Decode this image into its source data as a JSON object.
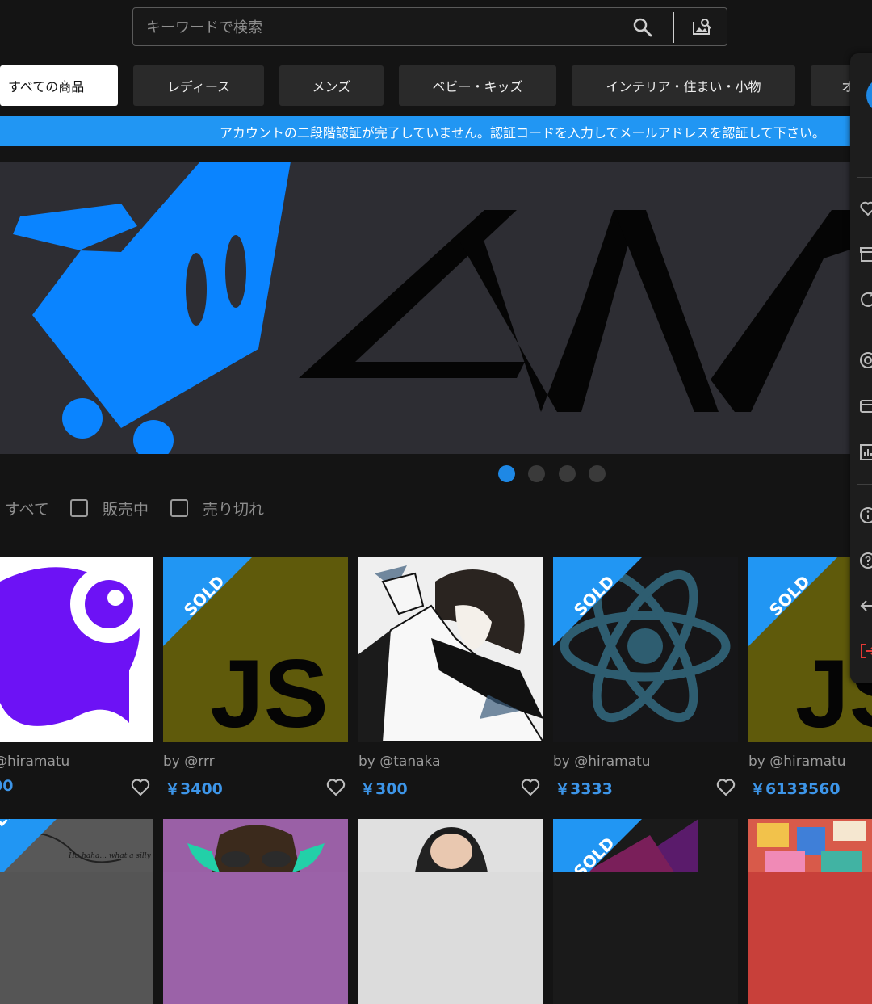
{
  "search": {
    "placeholder": "キーワードで検索",
    "search_icon": "search-icon",
    "image_search_icon": "image-search-icon"
  },
  "categories": [
    {
      "label": "すべての商品",
      "active": true
    },
    {
      "label": "レディース"
    },
    {
      "label": "メンズ"
    },
    {
      "label": "ベビー・キッズ"
    },
    {
      "label": "インテリア・住まい・小物"
    },
    {
      "label": "オ"
    }
  ],
  "notice": "アカウントの二段階認証が完了していません。認証コードを入力してメールアドレスを認証して下さい。",
  "colors": {
    "accent": "#2196f3",
    "price": "#3d95e8",
    "logo_blue": "#0a84ff",
    "sold_ribbon": "#2196f3"
  },
  "carousel": {
    "slides": 4,
    "active_index": 0
  },
  "filters": [
    {
      "label": "すべて"
    },
    {
      "label": "販売中",
      "checked": false
    },
    {
      "label": "売り切れ",
      "checked": false
    }
  ],
  "products": [
    {
      "seller": "@hiramatu",
      "price": "00",
      "sold": false
    },
    {
      "seller": "by @rrr",
      "price": "￥3400",
      "sold": true,
      "sold_label": "SOLD",
      "logo_text": "JS"
    },
    {
      "seller": "by @tanaka",
      "price": "￥300",
      "sold": false
    },
    {
      "seller": "by @hiramatu",
      "price": "￥3333",
      "sold": true,
      "sold_label": "SOLD"
    },
    {
      "seller": "by @hiramatu",
      "price": "￥6133560",
      "sold": true,
      "sold_label": "SOLD",
      "logo_text": "JS"
    }
  ],
  "row2": {
    "sold_label": "SOLD",
    "handwriting": "Ha haha... what a silly creature!!"
  },
  "drawer_icons": [
    "heart-icon",
    "archive-icon",
    "refresh-icon",
    "target-icon",
    "card-icon",
    "chart-icon",
    "info-icon",
    "help-icon",
    "back-arrow-icon",
    "logout-icon"
  ]
}
